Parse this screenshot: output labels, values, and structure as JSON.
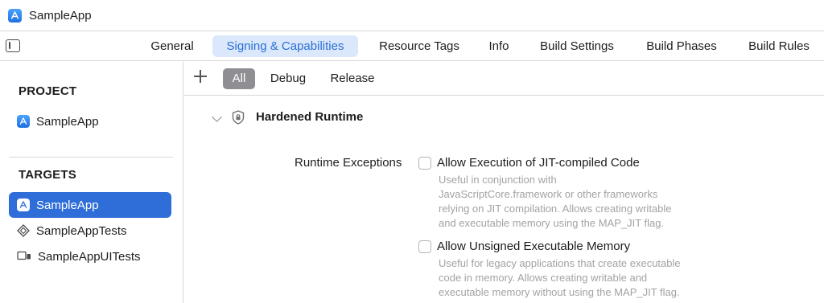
{
  "window": {
    "title": "SampleApp"
  },
  "tabs": [
    {
      "label": "General"
    },
    {
      "label": "Signing & Capabilities",
      "active": true
    },
    {
      "label": "Resource Tags"
    },
    {
      "label": "Info"
    },
    {
      "label": "Build Settings"
    },
    {
      "label": "Build Phases"
    },
    {
      "label": "Build Rules"
    }
  ],
  "sidebar": {
    "project_header": "PROJECT",
    "project_items": [
      {
        "label": "SampleApp",
        "icon": "app-icon"
      }
    ],
    "targets_header": "TARGETS",
    "target_items": [
      {
        "label": "SampleApp",
        "icon": "app-icon",
        "selected": true
      },
      {
        "label": "SampleAppTests",
        "icon": "test-diamond-icon"
      },
      {
        "label": "SampleAppUITests",
        "icon": "ui-test-icon"
      }
    ]
  },
  "filters": [
    {
      "label": "All",
      "active": true
    },
    {
      "label": "Debug"
    },
    {
      "label": "Release"
    }
  ],
  "capability": {
    "title": "Hardened Runtime",
    "field_label": "Runtime Exceptions",
    "options": [
      {
        "title": "Allow Execution of JIT-compiled Code",
        "checked": false,
        "description": [
          "Useful in conjunction with",
          "JavaScriptCore.framework or other frameworks",
          "relying on JIT compilation. Allows creating writable",
          "and executable memory using the MAP_JIT flag."
        ]
      },
      {
        "title": "Allow Unsigned Executable Memory",
        "checked": false,
        "description": [
          "Useful for legacy applications that create executable",
          "code in memory. Allows creating writable and",
          "executable memory without using the MAP_JIT flag."
        ]
      }
    ]
  },
  "colors": {
    "accent": "#2f6ed8",
    "tab_active_bg": "#dbe8fb",
    "tab_active_text": "#2a6fd6",
    "filter_active_bg": "#8e8e93",
    "muted_text": "#a3a3a6"
  }
}
